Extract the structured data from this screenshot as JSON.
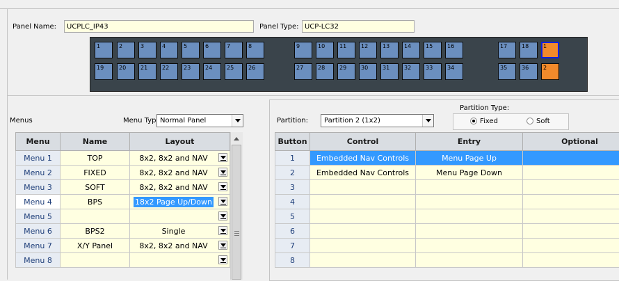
{
  "panel": {
    "name_label": "Panel Name:",
    "name_value": "UCPLC_IP43",
    "type_label": "Panel Type:",
    "type_value": "UCP-LC32"
  },
  "keys": {
    "row1": [
      "1",
      "2",
      "3",
      "4",
      "5",
      "6",
      "7",
      "8",
      "9",
      "10",
      "11",
      "12",
      "13",
      "14",
      "15",
      "16",
      "17",
      "18",
      "1"
    ],
    "row2": [
      "19",
      "20",
      "21",
      "22",
      "23",
      "24",
      "25",
      "26",
      "27",
      "28",
      "29",
      "30",
      "31",
      "32",
      "33",
      "34",
      "35",
      "36",
      "2"
    ]
  },
  "menus": {
    "label": "Menus",
    "type_label": "Menu Type:",
    "type_value": "Normal Panel",
    "columns": [
      "Menu",
      "Name",
      "Layout"
    ],
    "rows": [
      {
        "menu": "Menu 1",
        "name": "TOP",
        "layout": "8x2, 8x2 and NAV"
      },
      {
        "menu": "Menu 2",
        "name": "FIXED",
        "layout": "8x2, 8x2 and NAV"
      },
      {
        "menu": "Menu 3",
        "name": "SOFT",
        "layout": "8x2, 8x2 and NAV"
      },
      {
        "menu": "Menu 4",
        "name": "BPS",
        "layout": "18x2 Page Up/Down"
      },
      {
        "menu": "Menu 5",
        "name": "",
        "layout": ""
      },
      {
        "menu": "Menu 6",
        "name": "BPS2",
        "layout": "Single"
      },
      {
        "menu": "Menu 7",
        "name": "X/Y Panel",
        "layout": "8x2, 8x2 and NAV"
      },
      {
        "menu": "Menu 8",
        "name": "",
        "layout": ""
      }
    ]
  },
  "partition": {
    "label": "Partition:",
    "value": "Partition 2 (1x2)",
    "type_label": "Partition Type:",
    "fixed_label": "Fixed",
    "soft_label": "Soft",
    "columns": [
      "Button",
      "Control",
      "Entry",
      "Optional"
    ],
    "rows": [
      {
        "button": "1",
        "control": "Embedded Nav Controls",
        "entry": "Menu Page Up",
        "optional": ""
      },
      {
        "button": "2",
        "control": "Embedded Nav Controls",
        "entry": "Menu Page Down",
        "optional": ""
      },
      {
        "button": "3",
        "control": "",
        "entry": "",
        "optional": ""
      },
      {
        "button": "4",
        "control": "",
        "entry": "",
        "optional": ""
      },
      {
        "button": "5",
        "control": "",
        "entry": "",
        "optional": ""
      },
      {
        "button": "6",
        "control": "",
        "entry": "",
        "optional": ""
      },
      {
        "button": "7",
        "control": "",
        "entry": "",
        "optional": ""
      },
      {
        "button": "8",
        "control": "",
        "entry": "",
        "optional": ""
      }
    ]
  },
  "colors": {
    "key_blue": "#6b8fbf",
    "key_orange": "#f28a2b",
    "selection": "#3399ff",
    "cell_yellow": "#ffffe1"
  }
}
